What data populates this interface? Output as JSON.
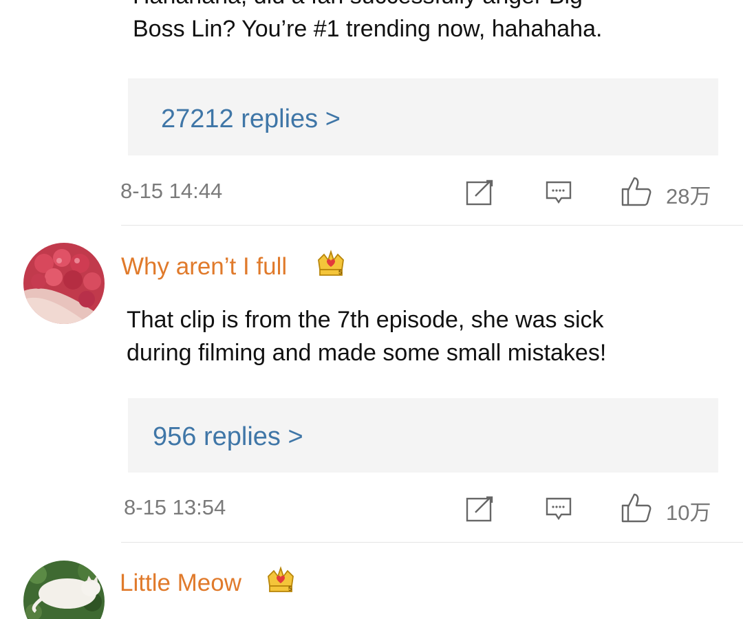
{
  "comments": [
    {
      "text_line1": "Hahahaha, did a fan successfully anger Big",
      "text_line2": "Boss Lin? You’re #1 trending now, hahahaha.",
      "replies": "27212 replies >",
      "timestamp": "8-15 14:44",
      "likes": "28万"
    },
    {
      "username": "Why aren’t I full",
      "text_line1": "That clip is from the 7th episode, she was sick",
      "text_line2": "during filming and made some small mistakes!",
      "replies": "956 replies >",
      "timestamp": "8-15 13:54",
      "likes": "10万"
    },
    {
      "username": "Little Meow"
    }
  ],
  "icons": {
    "repost": "repost-icon",
    "comment": "comment-icon",
    "like": "thumbs-up-icon",
    "badge": "crown-badge-icon"
  },
  "colors": {
    "username": "#e07a2b",
    "link": "#3f76a7",
    "meta": "#7a7a7a"
  }
}
